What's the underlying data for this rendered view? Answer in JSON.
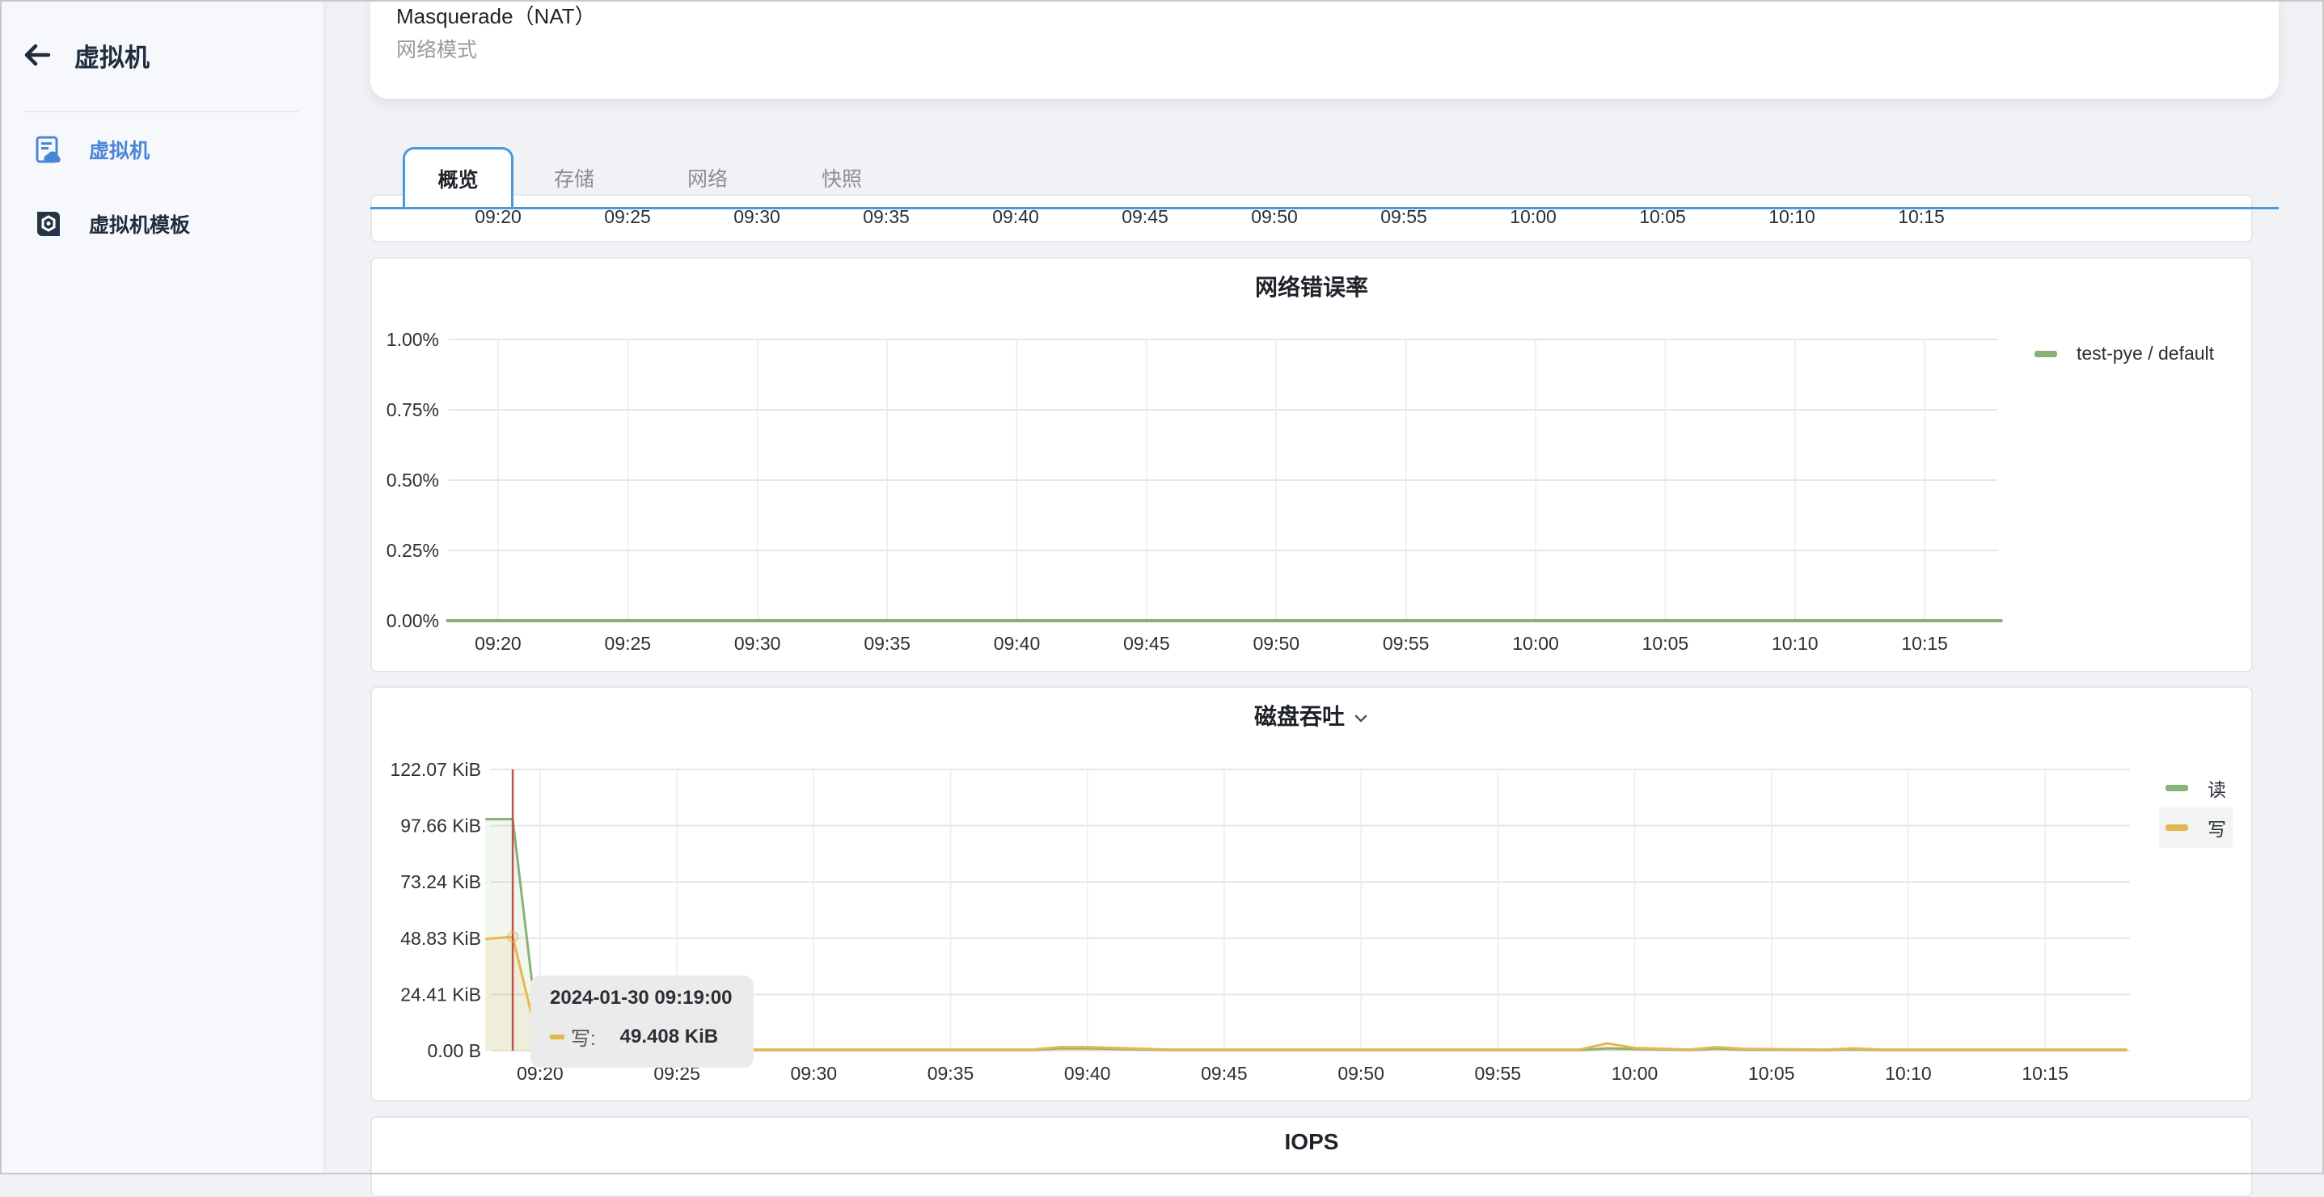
{
  "sidebar": {
    "back_title": "虚拟机",
    "items": [
      {
        "label": "虚拟机",
        "icon": "vm-cloud-icon",
        "active": true
      },
      {
        "label": "虚拟机模板",
        "icon": "vm-template-icon",
        "active": false
      }
    ]
  },
  "info_card": {
    "value": "Masquerade（NAT）",
    "label": "网络模式"
  },
  "tabs": [
    {
      "label": "概览",
      "active": true
    },
    {
      "label": "存储",
      "active": false
    },
    {
      "label": "网络",
      "active": false
    },
    {
      "label": "快照",
      "active": false
    }
  ],
  "colors": {
    "accent": "#4a9ad9",
    "read": "#8ab178",
    "write": "#e5b84e",
    "crosshair": "#c0504d"
  },
  "chart_data": [
    {
      "id": "clipped-top-chart",
      "type": "line",
      "title": "",
      "x_tick_labels": [
        "09:20",
        "09:25",
        "09:30",
        "09:35",
        "09:40",
        "09:45",
        "09:50",
        "09:55",
        "10:00",
        "10:05",
        "10:10",
        "10:15"
      ]
    },
    {
      "id": "network-error-rate",
      "type": "line",
      "title": "网络错误率",
      "xlabel": "",
      "ylabel": "",
      "x_range_minutes": [
        "09:18",
        "10:18"
      ],
      "x_tick_labels": [
        "09:20",
        "09:25",
        "09:30",
        "09:35",
        "09:40",
        "09:45",
        "09:50",
        "09:55",
        "10:00",
        "10:05",
        "10:10",
        "10:15"
      ],
      "y_tick_labels": [
        "0.00%",
        "0.25%",
        "0.50%",
        "0.75%",
        "1.00%"
      ],
      "ylim": [
        0,
        1.0
      ],
      "grid": true,
      "legend_position": "right",
      "series": [
        {
          "name": "test-pye / default",
          "color": "#8ab178",
          "x": [
            "09:18",
            "09:30",
            "09:45",
            "10:00",
            "10:18"
          ],
          "values": [
            0,
            0,
            0,
            0,
            0
          ]
        }
      ]
    },
    {
      "id": "disk-throughput",
      "type": "area",
      "title": "磁盘吞吐",
      "has_dropdown": true,
      "xlabel": "",
      "ylabel": "",
      "x_tick_labels": [
        "09:20",
        "09:25",
        "09:30",
        "09:35",
        "09:40",
        "09:45",
        "09:50",
        "09:55",
        "10:00",
        "10:05",
        "10:10",
        "10:15"
      ],
      "y_tick_labels": [
        "0.00 B",
        "24.41 KiB",
        "48.83 KiB",
        "73.24 KiB",
        "97.66 KiB",
        "122.07 KiB"
      ],
      "ylim_kib": [
        0,
        122.07
      ],
      "grid": true,
      "legend_position": "right",
      "series": [
        {
          "name": "读",
          "color": "#8ab178",
          "x": [
            "09:18",
            "09:19",
            "09:20",
            "09:38",
            "09:39",
            "09:40",
            "09:41",
            "09:43",
            "09:58",
            "09:59",
            "10:00",
            "10:02",
            "10:03",
            "10:04",
            "10:07",
            "10:08",
            "10:09",
            "10:18"
          ],
          "values": [
            100.5,
            100.5,
            0.3,
            0.3,
            1.0,
            1.0,
            0.8,
            0.3,
            0.3,
            1.0,
            0.8,
            0.3,
            1.0,
            0.5,
            0.3,
            0.6,
            0.3,
            0.3
          ]
        },
        {
          "name": "写",
          "color": "#e5b84e",
          "x": [
            "09:18",
            "09:19",
            "09:20",
            "09:38",
            "09:39",
            "09:40",
            "09:41",
            "09:43",
            "09:58",
            "09:59",
            "10:00",
            "10:02",
            "10:03",
            "10:04",
            "10:07",
            "10:08",
            "10:09",
            "10:18"
          ],
          "values": [
            48.5,
            49.408,
            0.5,
            0.5,
            1.6,
            1.6,
            1.2,
            0.5,
            0.5,
            3.2,
            1.2,
            0.5,
            1.6,
            0.8,
            0.5,
            1.0,
            0.5,
            0.5
          ]
        }
      ],
      "hover": {
        "time": "09:19"
      },
      "tooltip": {
        "time": "2024-01-30 09:19:00",
        "series": "写:",
        "value": "49.408 KiB"
      }
    },
    {
      "id": "iops",
      "type": "line",
      "title": "IOPS"
    }
  ]
}
